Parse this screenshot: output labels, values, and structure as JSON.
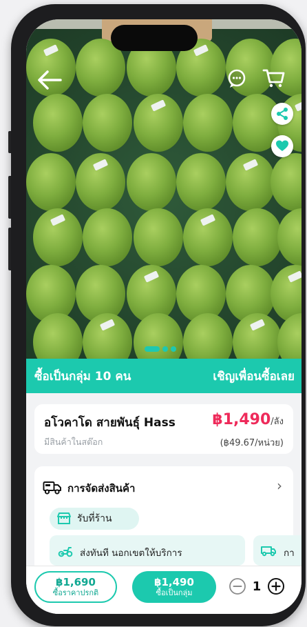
{
  "hero": {
    "colors": {
      "avocado": "#7fae3f",
      "avocado_dark": "#5d8a28",
      "tray": "#24462d"
    },
    "carousel": {
      "count": 3,
      "active_index": 0
    }
  },
  "topbar": {
    "back_icon": "arrow-left-icon",
    "chat_icon": "chat-bubble-icon",
    "cart_icon": "cart-icon",
    "share_icon": "share-icon",
    "favorite_icon": "heart-icon"
  },
  "group_banner": {
    "left_text": "ซื้อเป็นกลุ่ม 10 คน",
    "right_text": "เชิญเพื่อนซื้อเลย",
    "color": "#1cc9ae"
  },
  "product": {
    "name": "อโวคาโด สายพันธุ์ Hass",
    "stock_status": "มีสินค้าในสต๊อก",
    "price": "฿1,490",
    "price_unit": "/ลัง",
    "price_per_unit": "(฿49.67/หน่วย)",
    "price_color": "#ee2a5a"
  },
  "shipping": {
    "title": "การจัดส่งสินค้า",
    "pickup_label": "รับที่ร้าน",
    "delivery_label": "ส่งทันที นอกเขตให้บริการ",
    "delivery2_label": "กา"
  },
  "bottom_bar": {
    "normal_price": "฿1,690",
    "normal_label": "ซื้อราคาปรกติ",
    "group_price": "฿1,490",
    "group_label": "ซื้อเป็นกลุ่ม",
    "quantity": "1"
  }
}
